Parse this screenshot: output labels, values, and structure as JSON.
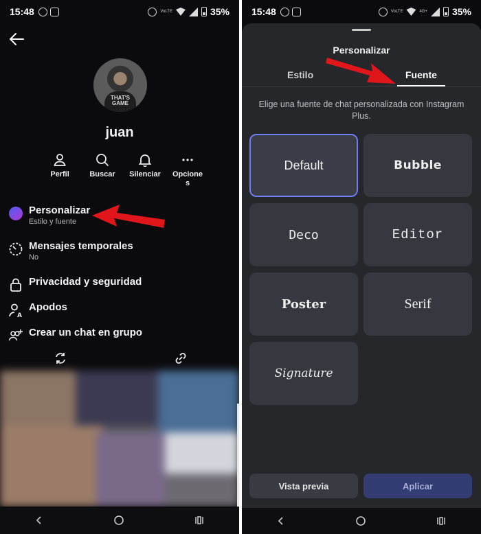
{
  "status_bar": {
    "time": "15:48",
    "battery": "35%",
    "network_top": "VoLTE",
    "network_label": "4G+"
  },
  "profile": {
    "username": "juan",
    "avatar_text": "THAT'S GAME",
    "actions": [
      {
        "label": "Perfil",
        "icon": "person-icon"
      },
      {
        "label": "Buscar",
        "icon": "search-icon"
      },
      {
        "label": "Silenciar",
        "icon": "bell-icon"
      },
      {
        "label": "Opcione s",
        "icon": "more-icon"
      }
    ],
    "menu": [
      {
        "title": "Personalizar",
        "subtitle": "Estilo y fuente",
        "icon": "theme-dot-icon"
      },
      {
        "title": "Mensajes temporales",
        "subtitle": "No",
        "icon": "timer-icon"
      },
      {
        "title": "Privacidad y seguridad",
        "subtitle": "",
        "icon": "lock-icon"
      },
      {
        "title": "Apodos",
        "subtitle": "",
        "icon": "nickname-icon"
      },
      {
        "title": "Crear un chat en grupo",
        "subtitle": "",
        "icon": "group-add-icon"
      }
    ]
  },
  "personalize": {
    "title": "Personalizar",
    "tabs": [
      {
        "label": "Estilo",
        "active": false
      },
      {
        "label": "Fuente",
        "active": true
      }
    ],
    "description": "Elige una fuente de chat personalizada con Instagram Plus.",
    "fonts": [
      {
        "label": "Default",
        "selected": true
      },
      {
        "label": "Bubble",
        "selected": false
      },
      {
        "label": "Deco",
        "selected": false
      },
      {
        "label": "Editor",
        "selected": false
      },
      {
        "label": "Poster",
        "selected": false
      },
      {
        "label": "Serif",
        "selected": false
      },
      {
        "label": "Signature",
        "selected": false
      }
    ],
    "preview_button": "Vista previa",
    "apply_button": "Aplicar"
  },
  "colors": {
    "accent_selected_border": "#6f7df0",
    "apply_button": "#343c74",
    "annotation_arrow": "#e0161b"
  }
}
